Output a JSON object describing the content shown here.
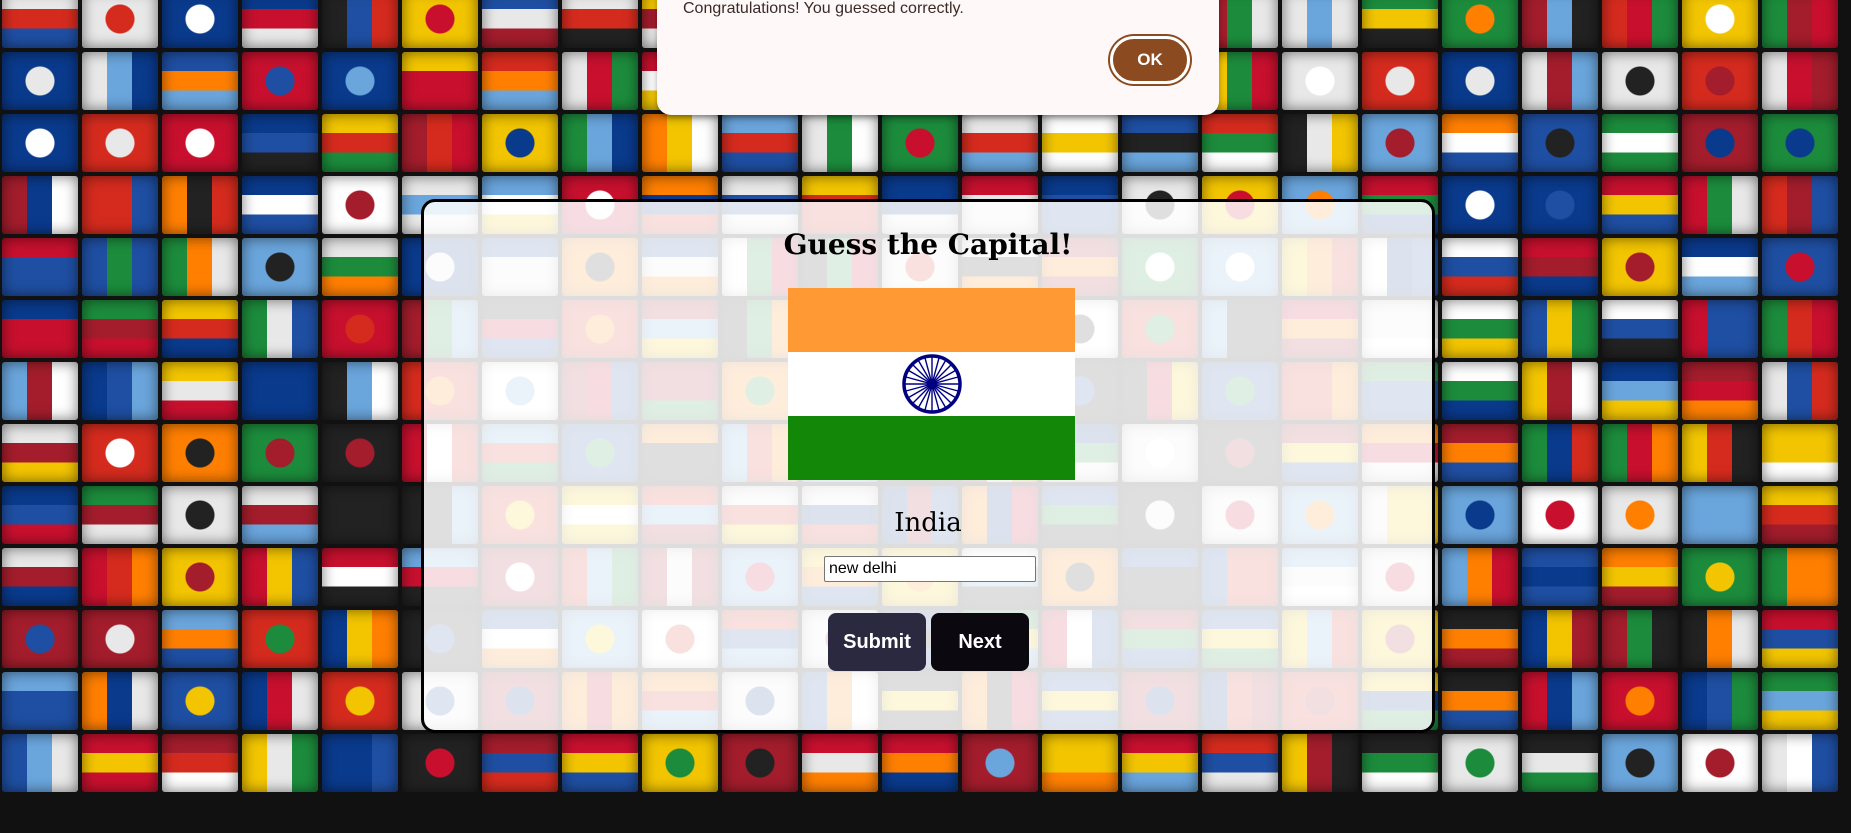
{
  "colors": {
    "tile_palette": [
      "#c8102e",
      "#1f4fa3",
      "#f2c500",
      "#1c8c3c",
      "#ffffff",
      "#e8e8e8",
      "#d52b1e",
      "#0a3a8c",
      "#222222",
      "#ff7f00",
      "#6aa5dc",
      "#a31d2c"
    ]
  },
  "dialog": {
    "message": "Congratulations! You guessed correctly.",
    "ok_label": "OK"
  },
  "game": {
    "title": "Guess the Capital!",
    "country": "India",
    "flag": {
      "icon": "india-flag-icon",
      "colors": {
        "top": "#ff9933",
        "middle": "#ffffff",
        "bottom": "#138808",
        "chakra": "#000080"
      }
    },
    "answer_value": "new delhi",
    "submit_label": "Submit",
    "next_label": "Next"
  }
}
